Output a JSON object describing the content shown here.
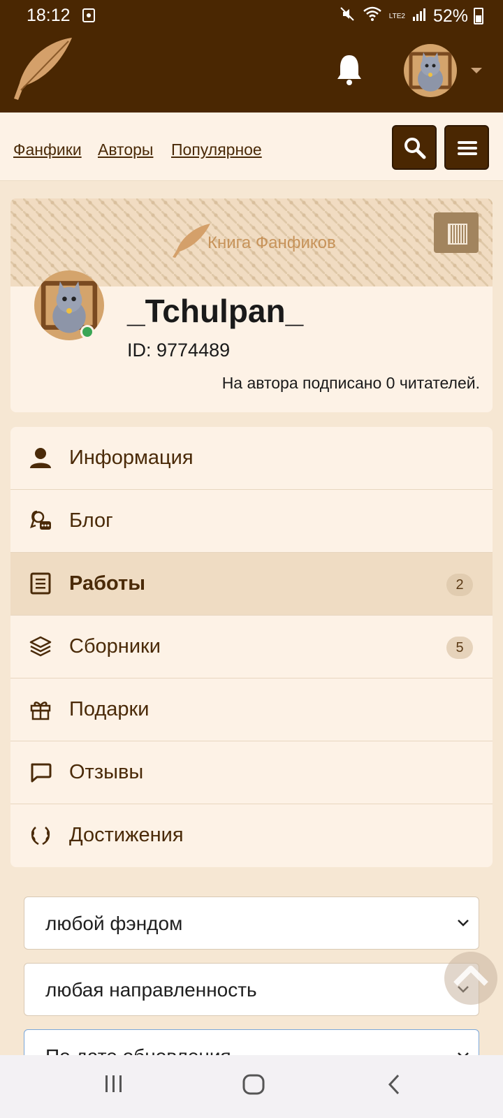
{
  "status_bar": {
    "time": "18:12",
    "battery": "52%",
    "network": "LTE2"
  },
  "header": {
    "logo_icon": "quill-icon",
    "bell_icon": "bell-icon",
    "avatar_icon": "cat-avatar"
  },
  "nav": {
    "links": [
      "Фанфики",
      "Авторы",
      "Популярное"
    ],
    "search_icon": "search-icon",
    "menu_icon": "hamburger-icon"
  },
  "profile": {
    "banner_title": "Книга Фанфиков",
    "username": "_Tchulpan_",
    "id_text": "ID: 9774489",
    "subscribers_text": "На автора подписано 0 читателей.",
    "online": true
  },
  "menu": {
    "items": [
      {
        "label": "Информация",
        "icon": "user-icon",
        "badge": ""
      },
      {
        "label": "Блог",
        "icon": "blog-icon",
        "badge": ""
      },
      {
        "label": "Работы",
        "icon": "document-icon",
        "badge": "2",
        "active": true
      },
      {
        "label": "Сборники",
        "icon": "layers-icon",
        "badge": "5"
      },
      {
        "label": "Подарки",
        "icon": "gift-icon",
        "badge": ""
      },
      {
        "label": "Отзывы",
        "icon": "comment-icon",
        "badge": ""
      },
      {
        "label": "Достижения",
        "icon": "laurel-icon",
        "badge": ""
      }
    ]
  },
  "filters": {
    "fandom": "любой фэндом",
    "direction": "любая направленность",
    "sort": "По дате обновления"
  },
  "colors": {
    "brand_dark": "#4a2702",
    "card_bg": "#fdf2e6",
    "page_bg": "#f6e7d3",
    "online": "#3aa655"
  }
}
